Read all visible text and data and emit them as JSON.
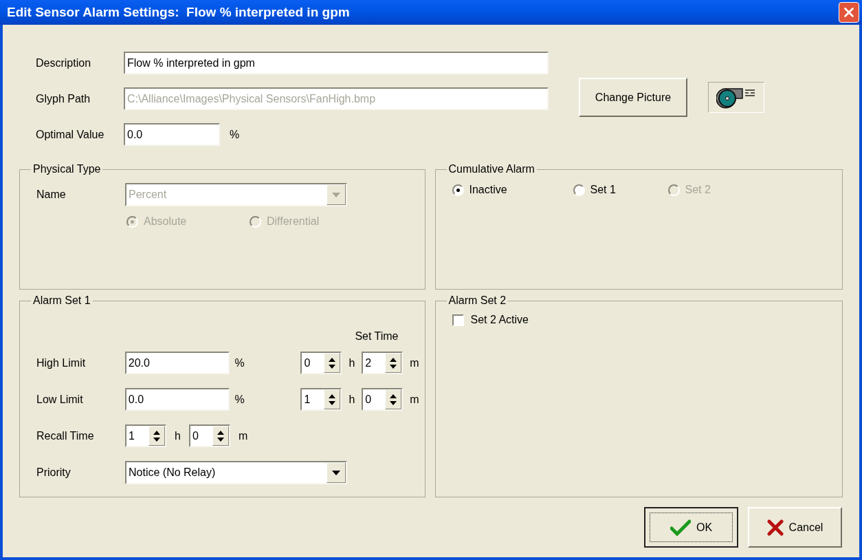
{
  "window": {
    "title": "Edit Sensor Alarm Settings:  Flow % interpreted in gpm"
  },
  "description": {
    "label": "Description",
    "value": "Flow % interpreted in gpm",
    "disabled": false
  },
  "glyph_path": {
    "label": "Glyph Path",
    "value": "C:\\Alliance\\Images\\Physical Sensors\\FanHigh.bmp",
    "disabled": true
  },
  "change_picture_button": {
    "label": "Change Picture"
  },
  "optimal_value": {
    "label": "Optimal Value",
    "value": "0.0",
    "unit": "%"
  },
  "physical_type": {
    "title": "Physical Type",
    "name_label": "Name",
    "name_value": "Percent",
    "disabled": true,
    "options": [
      {
        "label": "Absolute",
        "selected": true
      },
      {
        "label": "Differential",
        "selected": false
      }
    ]
  },
  "cumulative_alarm": {
    "title": "Cumulative Alarm",
    "options": [
      {
        "label": "Inactive",
        "selected": true,
        "disabled": false
      },
      {
        "label": "Set 1",
        "selected": false,
        "disabled": false
      },
      {
        "label": "Set 2",
        "selected": false,
        "disabled": true
      }
    ]
  },
  "alarm_set_1": {
    "title": "Alarm Set 1",
    "set_time_label": "Set Time",
    "limits": [
      {
        "label": "High Limit",
        "value": "20.0",
        "unit": "%",
        "hours": "0",
        "hours_unit": "h",
        "minutes": "2",
        "minutes_unit": "m"
      },
      {
        "label": "Low Limit",
        "value": "0.0",
        "unit": "%",
        "hours": "1",
        "hours_unit": "h",
        "minutes": "0",
        "minutes_unit": "m"
      }
    ],
    "recall": {
      "label": "Recall Time",
      "hours": "1",
      "hours_unit": "h",
      "minutes": "0",
      "minutes_unit": "m"
    },
    "priority": {
      "label": "Priority",
      "value": "Notice (No Relay)"
    }
  },
  "alarm_set_2": {
    "title": "Alarm Set 2",
    "checkbox": {
      "label": "Set 2 Active",
      "checked": false
    }
  },
  "buttons": [
    {
      "label": "OK",
      "kind": "ok",
      "default": true
    },
    {
      "label": "Cancel",
      "kind": "cancel",
      "default": false
    }
  ]
}
